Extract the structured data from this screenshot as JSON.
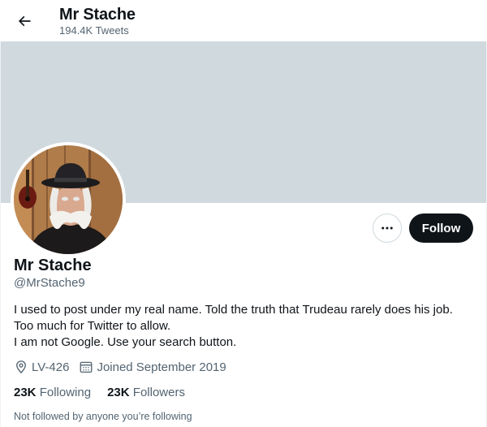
{
  "header": {
    "name": "Mr Stache",
    "tweet_count": "194.4K Tweets"
  },
  "profile": {
    "display_name": "Mr Stache",
    "handle": "@MrStache9",
    "bio": [
      "I used to post under my real name. Told the truth that Trudeau rarely does his job.",
      "Too much for Twitter to allow.",
      "I am not Google. Use your search button."
    ],
    "location": "LV-426",
    "joined": "Joined September 2019",
    "following_count": "23K",
    "following_label": "Following",
    "followers_count": "23K",
    "followers_label": "Followers",
    "mutual_note": "Not followed by anyone you’re following"
  },
  "actions": {
    "follow_label": "Follow",
    "more_icon": "ellipsis-icon"
  },
  "colors": {
    "banner": "#cfd9de",
    "text_primary": "#0f1419",
    "text_secondary": "#536471",
    "button_dark": "#0f1419"
  }
}
